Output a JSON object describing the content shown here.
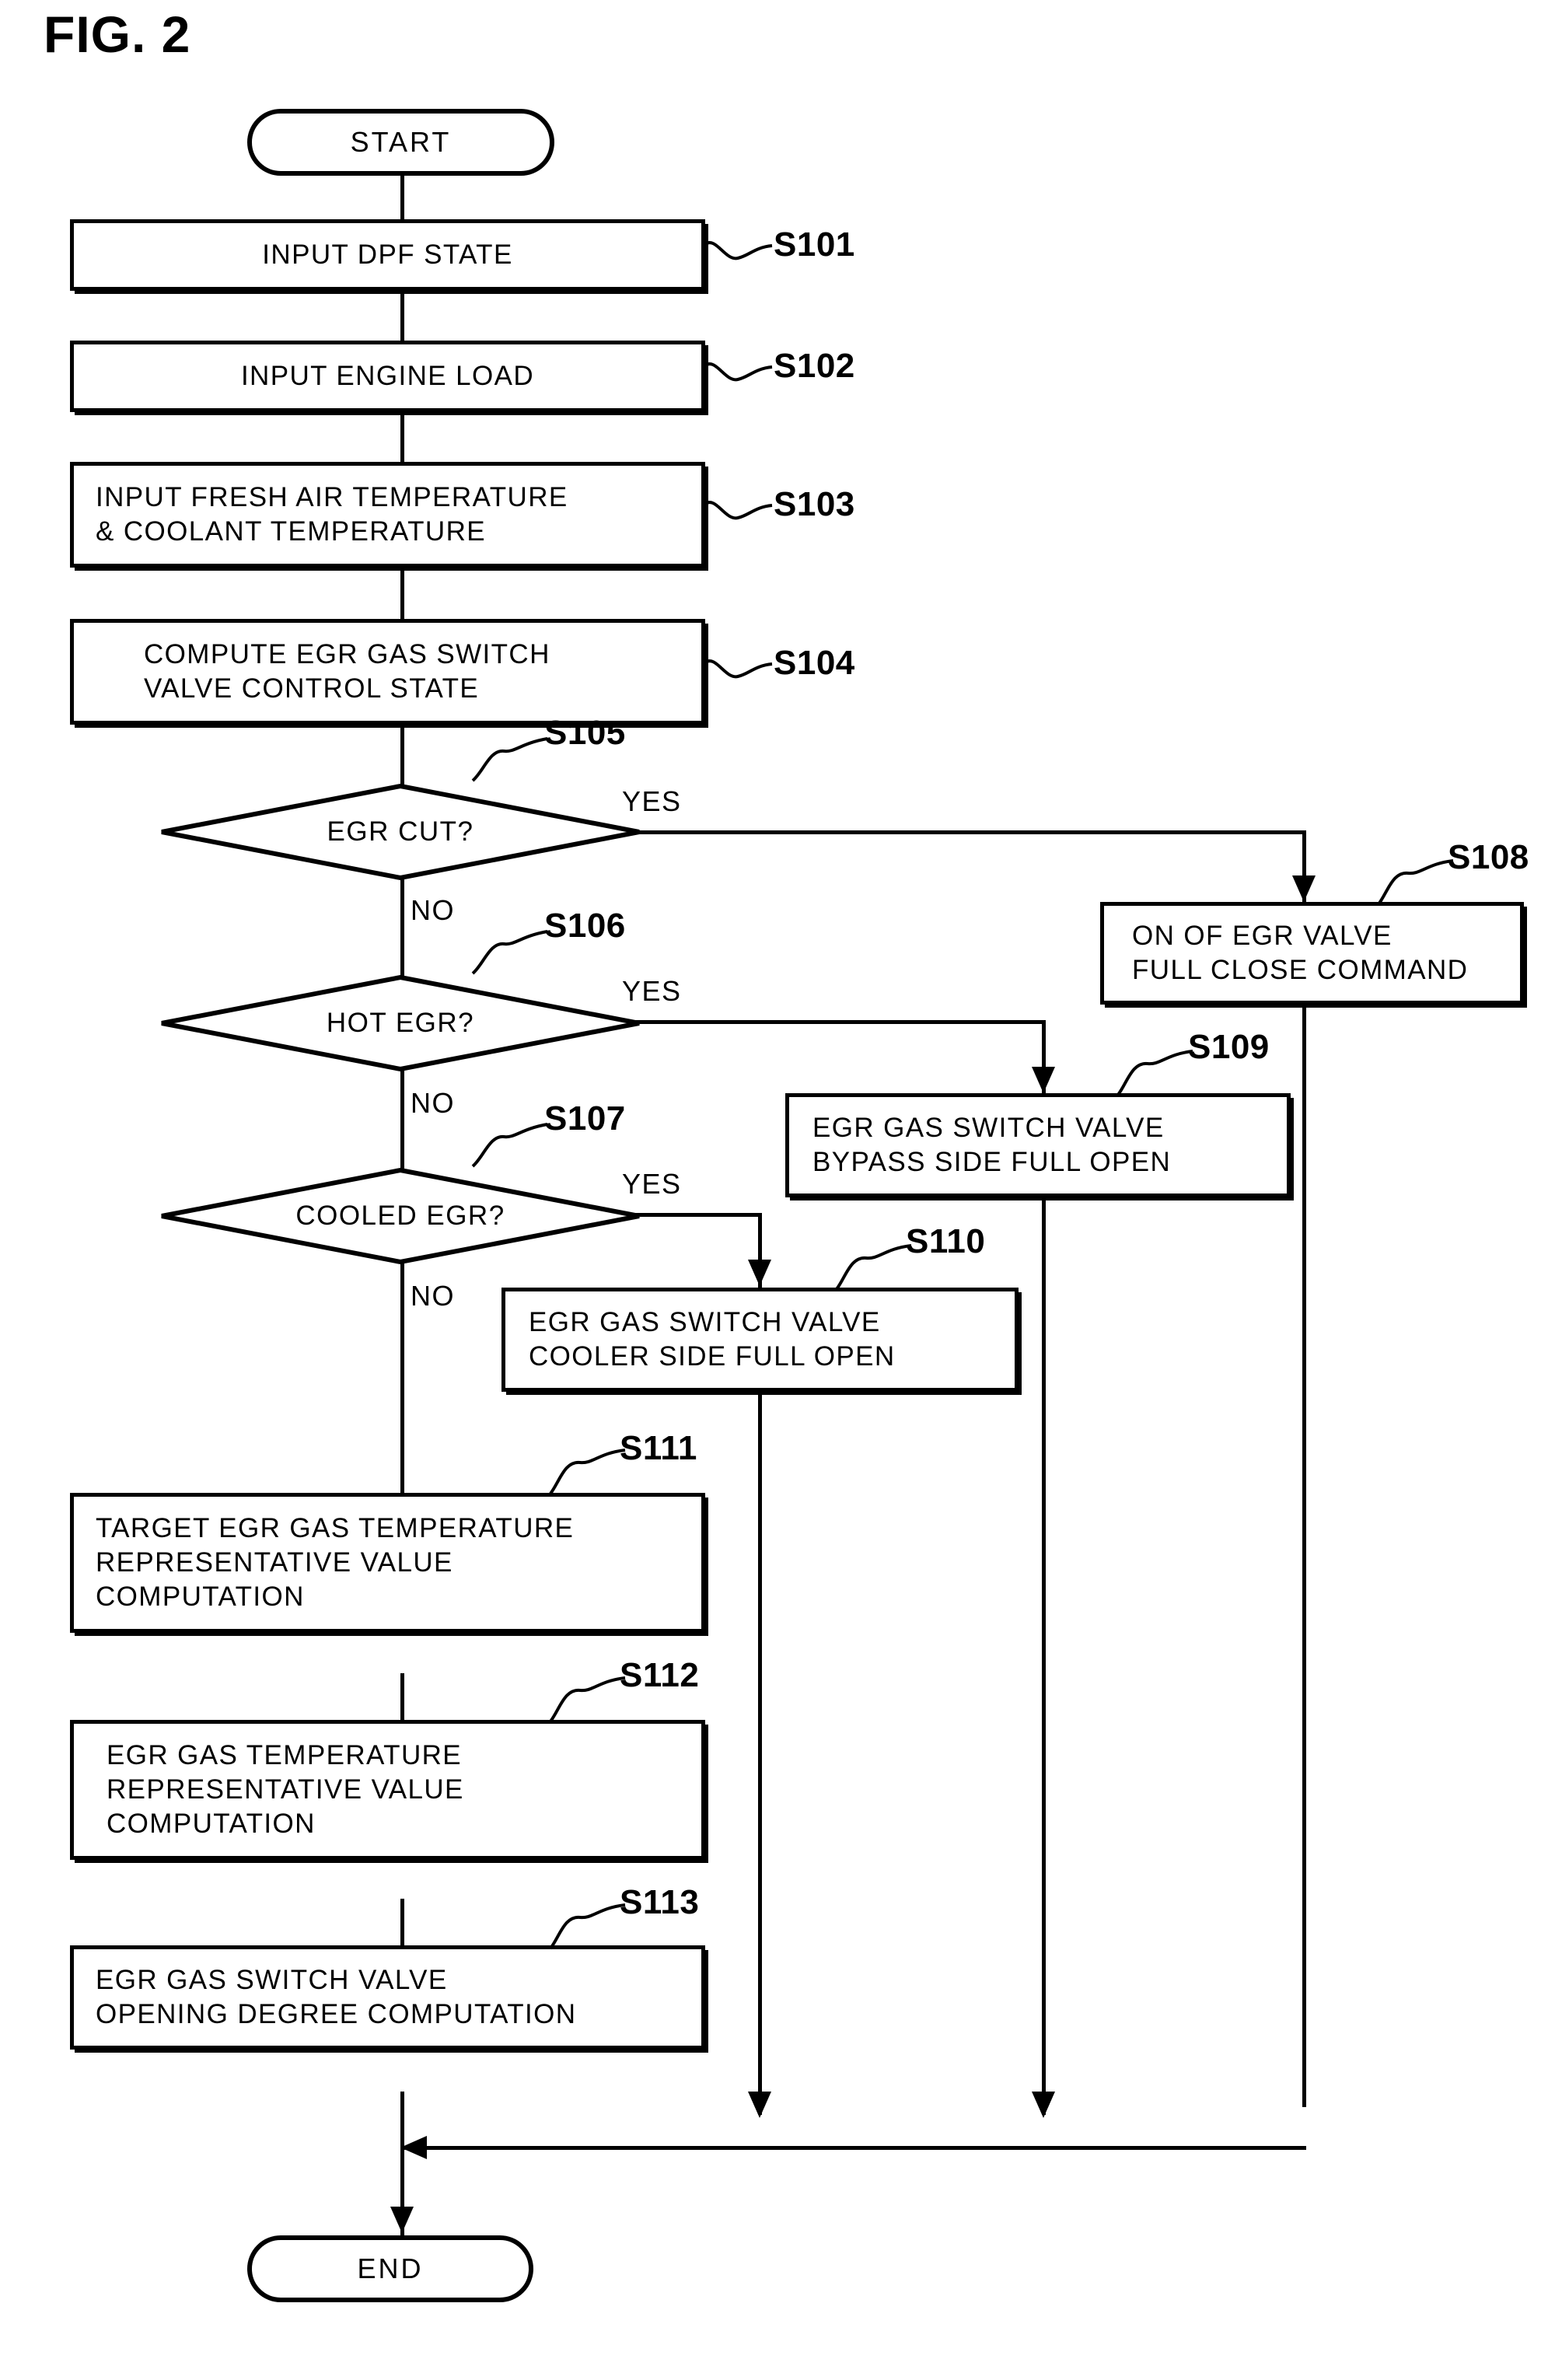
{
  "figure": {
    "title": "FIG. 2",
    "type": "flowchart"
  },
  "nodes": {
    "start": {
      "label": "START",
      "shape": "terminator"
    },
    "end": {
      "label": "END",
      "shape": "terminator"
    },
    "s101": {
      "step": "S101",
      "label": "INPUT DPF STATE",
      "shape": "process"
    },
    "s102": {
      "step": "S102",
      "label": "INPUT ENGINE LOAD",
      "shape": "process"
    },
    "s103": {
      "step": "S103",
      "label": "INPUT FRESH AIR TEMPERATURE\n& COOLANT TEMPERATURE",
      "shape": "process"
    },
    "s104": {
      "step": "S104",
      "label": "COMPUTE EGR GAS SWITCH\nVALVE CONTROL STATE",
      "shape": "process"
    },
    "s105": {
      "step": "S105",
      "label": "EGR CUT?",
      "shape": "decision"
    },
    "s106": {
      "step": "S106",
      "label": "HOT EGR?",
      "shape": "decision"
    },
    "s107": {
      "step": "S107",
      "label": "COOLED EGR?",
      "shape": "decision"
    },
    "s108": {
      "step": "S108",
      "label": "ON OF EGR VALVE\nFULL CLOSE COMMAND",
      "shape": "process"
    },
    "s109": {
      "step": "S109",
      "label": "EGR GAS SWITCH VALVE\nBYPASS SIDE FULL OPEN",
      "shape": "process"
    },
    "s110": {
      "step": "S110",
      "label": "EGR GAS SWITCH VALVE\nCOOLER SIDE FULL OPEN",
      "shape": "process"
    },
    "s111": {
      "step": "S111",
      "label": "TARGET EGR GAS TEMPERATURE\nREPRESENTATIVE VALUE\nCOMPUTATION",
      "shape": "process"
    },
    "s112": {
      "step": "S112",
      "label": "EGR GAS TEMPERATURE\nREPRESENTATIVE VALUE\nCOMPUTATION",
      "shape": "process"
    },
    "s113": {
      "step": "S113",
      "label": "EGR GAS SWITCH VALVE\nOPENING DEGREE COMPUTATION",
      "shape": "process"
    }
  },
  "edge_labels": {
    "s105_yes": "YES",
    "s105_no": "NO",
    "s106_yes": "YES",
    "s106_no": "NO",
    "s107_yes": "YES",
    "s107_no": "NO"
  },
  "colors": {
    "stroke": "#000000",
    "background": "#ffffff"
  }
}
